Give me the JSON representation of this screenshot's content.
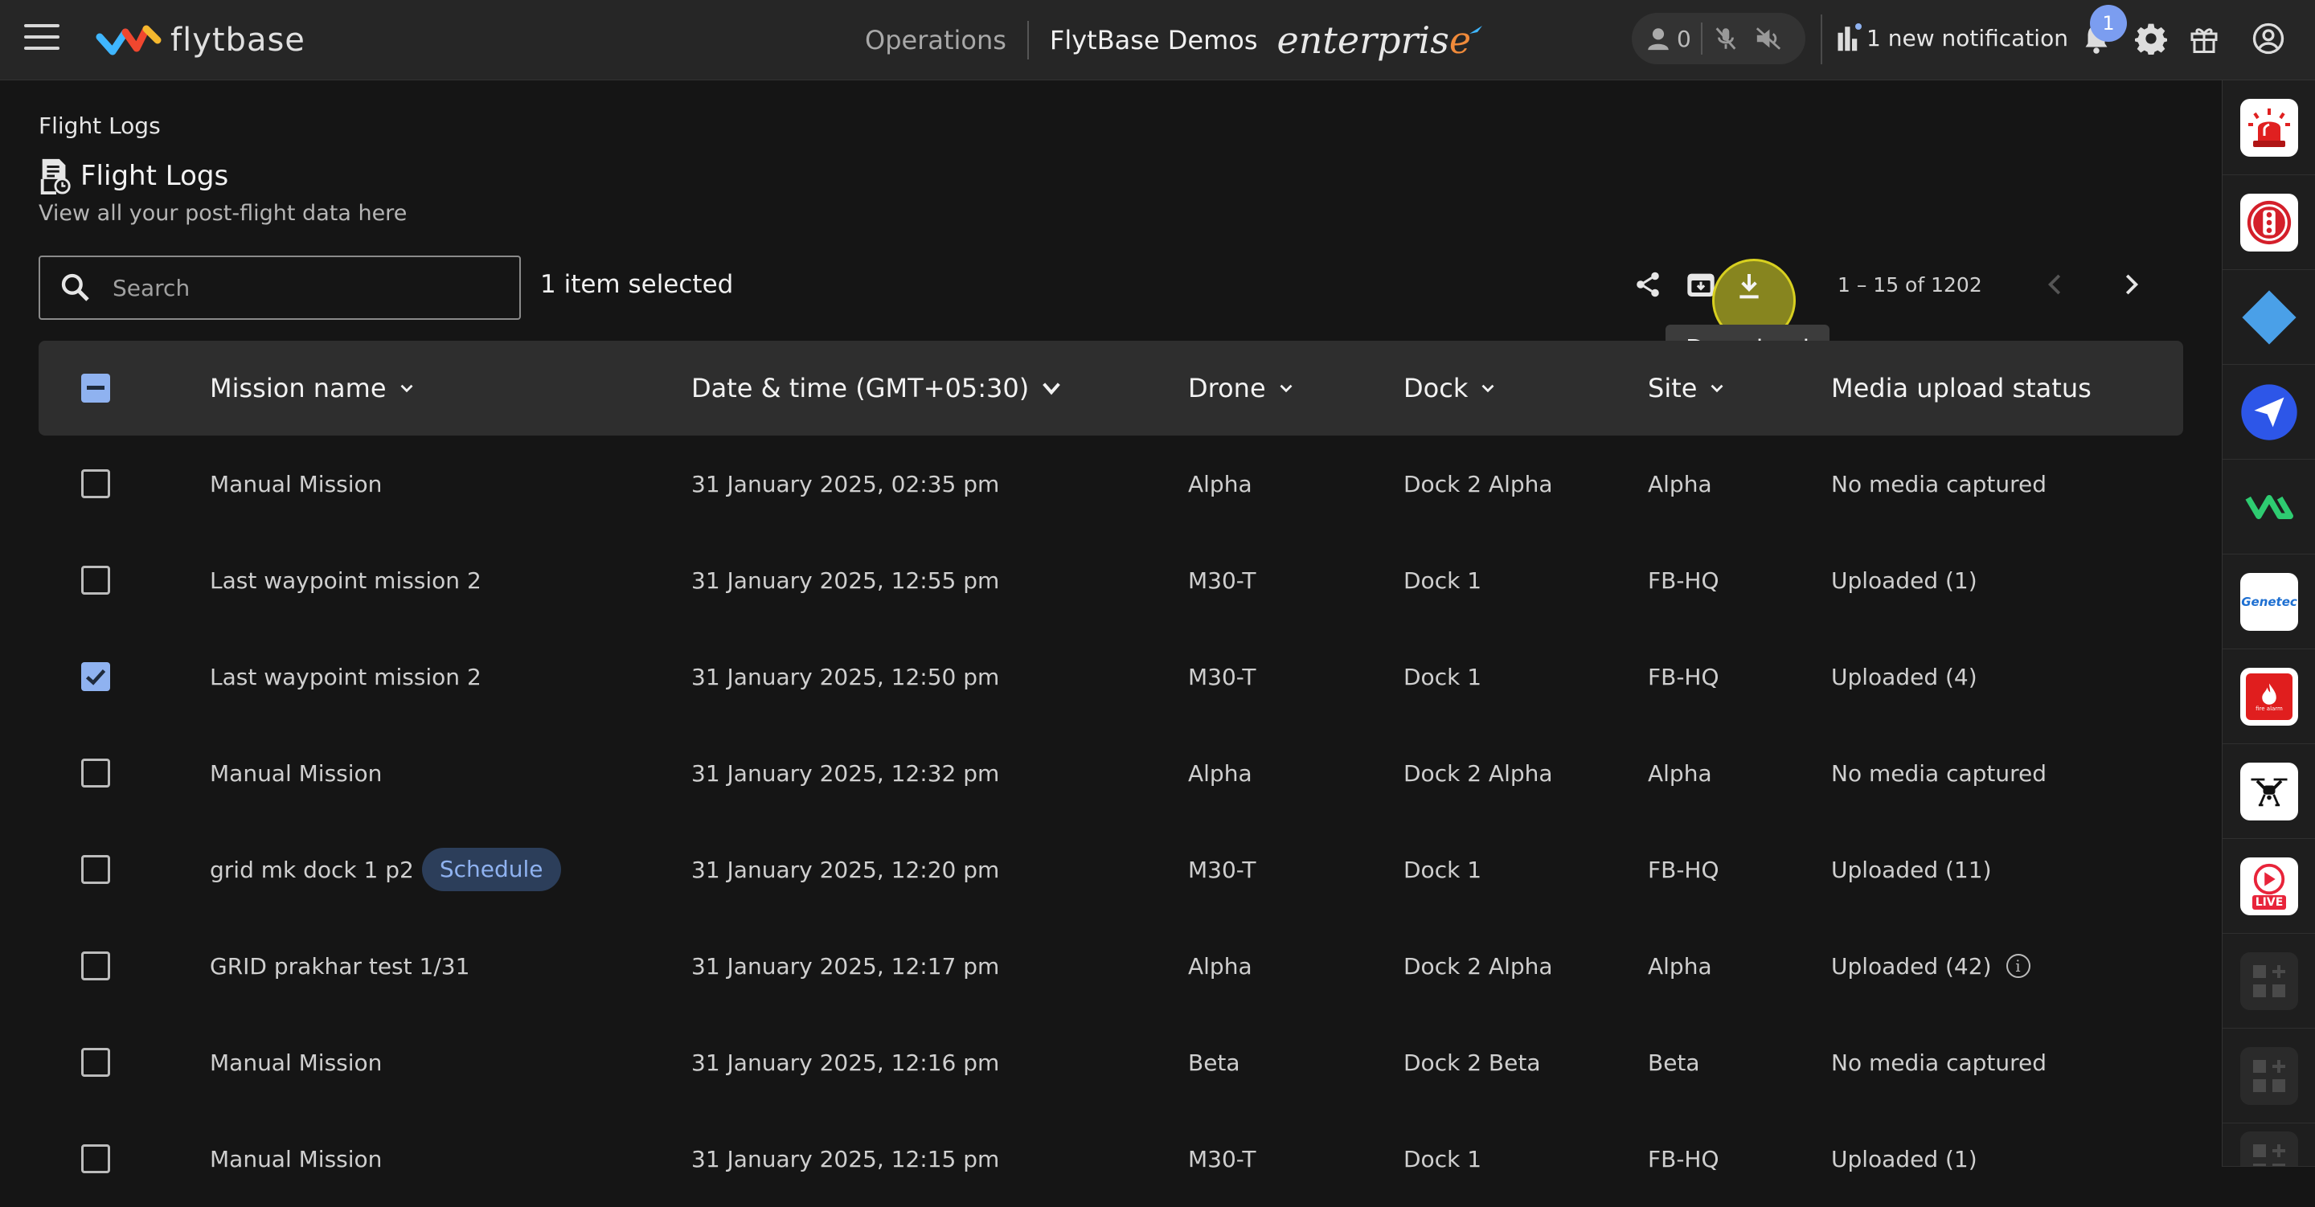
{
  "topbar": {
    "logo_text": "flytbase",
    "nav_operations": "Operations",
    "org_name": "FlytBase Demos",
    "edition_main": "enterpris",
    "edition_end": "e",
    "user_count": "0",
    "notification_text": "1 new notification",
    "notification_badge": "1"
  },
  "page": {
    "breadcrumb": "Flight Logs",
    "title": "Flight Logs",
    "subtitle": "View all your post-flight data here"
  },
  "toolbar": {
    "search_placeholder": "Search",
    "selected_text": "1 item selected",
    "tooltip": "Download",
    "pagination": "1 – 15 of 1202"
  },
  "table": {
    "columns": [
      "Mission name",
      "Date & time (GMT+05:30)",
      "Drone",
      "Dock",
      "Site",
      "Media upload status"
    ],
    "rows": [
      {
        "mission": "Manual Mission",
        "tag": "",
        "datetime": "31 January 2025, 02:35 pm",
        "drone": "Alpha",
        "dock": "Dock 2 Alpha",
        "site": "Alpha",
        "media": "No media captured",
        "checked": false,
        "info": false
      },
      {
        "mission": "Last waypoint mission 2",
        "tag": "",
        "datetime": "31 January 2025, 12:55 pm",
        "drone": "M30-T",
        "dock": "Dock 1",
        "site": "FB-HQ",
        "media": "Uploaded (1)",
        "checked": false,
        "info": false
      },
      {
        "mission": "Last waypoint mission 2",
        "tag": "",
        "datetime": "31 January 2025, 12:50 pm",
        "drone": "M30-T",
        "dock": "Dock 1",
        "site": "FB-HQ",
        "media": "Uploaded (4)",
        "checked": true,
        "info": false
      },
      {
        "mission": "Manual Mission",
        "tag": "",
        "datetime": "31 January 2025, 12:32 pm",
        "drone": "Alpha",
        "dock": "Dock 2 Alpha",
        "site": "Alpha",
        "media": "No media captured",
        "checked": false,
        "info": false
      },
      {
        "mission": "grid mk dock 1 p2",
        "tag": "Schedule",
        "datetime": "31 January 2025, 12:20 pm",
        "drone": "M30-T",
        "dock": "Dock 1",
        "site": "FB-HQ",
        "media": "Uploaded (11)",
        "checked": false,
        "info": false
      },
      {
        "mission": "GRID prakhar test 1/31",
        "tag": "",
        "datetime": "31 January 2025, 12:17 pm",
        "drone": "Alpha",
        "dock": "Dock 2 Alpha",
        "site": "Alpha",
        "media": "Uploaded (42)",
        "checked": false,
        "info": true
      },
      {
        "mission": "Manual Mission",
        "tag": "",
        "datetime": "31 January 2025, 12:16 pm",
        "drone": "Beta",
        "dock": "Dock 2 Beta",
        "site": "Beta",
        "media": "No media captured",
        "checked": false,
        "info": false
      },
      {
        "mission": "Manual Mission",
        "tag": "",
        "datetime": "31 January 2025, 12:15 pm",
        "drone": "M30-T",
        "dock": "Dock 1",
        "site": "FB-HQ",
        "media": "Uploaded (1)",
        "checked": false,
        "info": false
      }
    ]
  },
  "rail": {
    "apps": [
      "alarm-siren-icon",
      "traffic-light-icon",
      "diamond-icon",
      "send-arrow-icon",
      "va-logo-icon",
      "genetec-logo-icon",
      "fire-alarm-icon",
      "drone-icon",
      "live-stream-icon",
      "add-app-icon",
      "add-app-icon",
      "add-app-icon"
    ],
    "genetec_label": "Genetec",
    "fire_label": "fire alarm",
    "live_label": "LIVE"
  },
  "colors": {
    "accent": "#8fb2f0",
    "highlight": "#e6e128",
    "logo_orange": "#f08a3a"
  }
}
